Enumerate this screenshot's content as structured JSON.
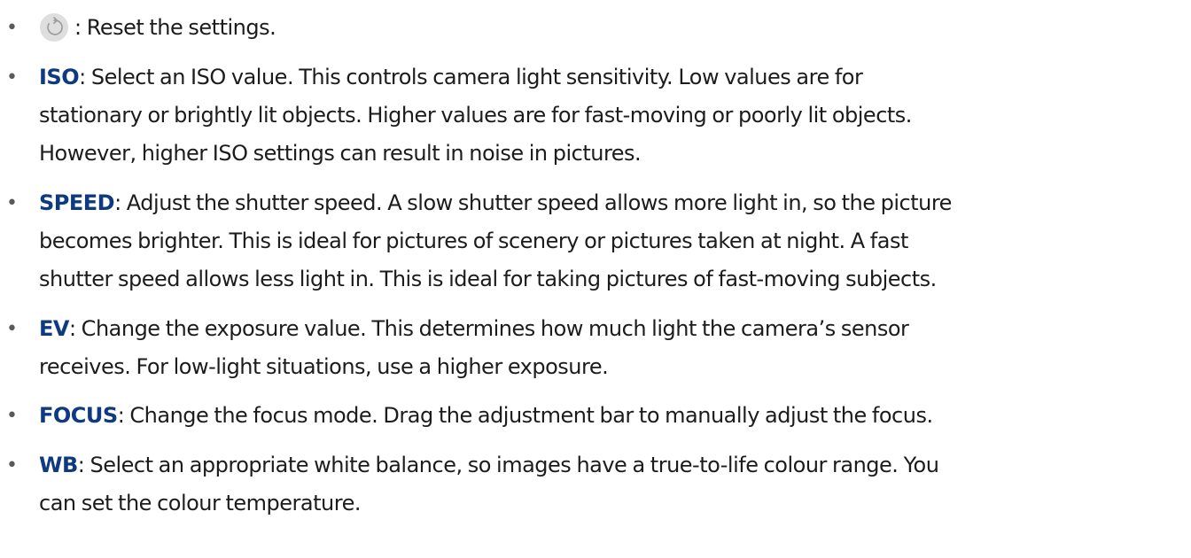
{
  "colors": {
    "term": "#0d3a80",
    "text": "#1c1c1c",
    "icon_bg": "#dedede",
    "icon_stroke": "#9a9a9a"
  },
  "items": [
    {
      "icon": "reset-icon",
      "lines": [
        ": Reset the settings."
      ]
    },
    {
      "term": "ISO",
      "lines": [
        ": Select an ISO value. This controls camera light sensitivity. Low values are for",
        "stationary or brightly lit objects. Higher values are for fast-moving or poorly lit objects.",
        "However, higher ISO settings can result in noise in pictures."
      ]
    },
    {
      "term": "SPEED",
      "lines": [
        ": Adjust the shutter speed. A slow shutter speed allows more light in, so the picture",
        "becomes brighter. This is ideal for pictures of scenery or pictures taken at night. A fast",
        "shutter speed allows less light in. This is ideal for taking pictures of fast-moving subjects."
      ]
    },
    {
      "term": "EV",
      "lines": [
        ": Change the exposure value. This determines how much light the camera’s sensor",
        "receives. For low-light situations, use a higher exposure."
      ]
    },
    {
      "term": "FOCUS",
      "lines": [
        ": Change the focus mode. Drag the adjustment bar to manually adjust the focus."
      ]
    },
    {
      "term": "WB",
      "lines": [
        ": Select an appropriate white balance, so images have a true-to-life colour range. You",
        "can set the colour temperature."
      ]
    }
  ]
}
